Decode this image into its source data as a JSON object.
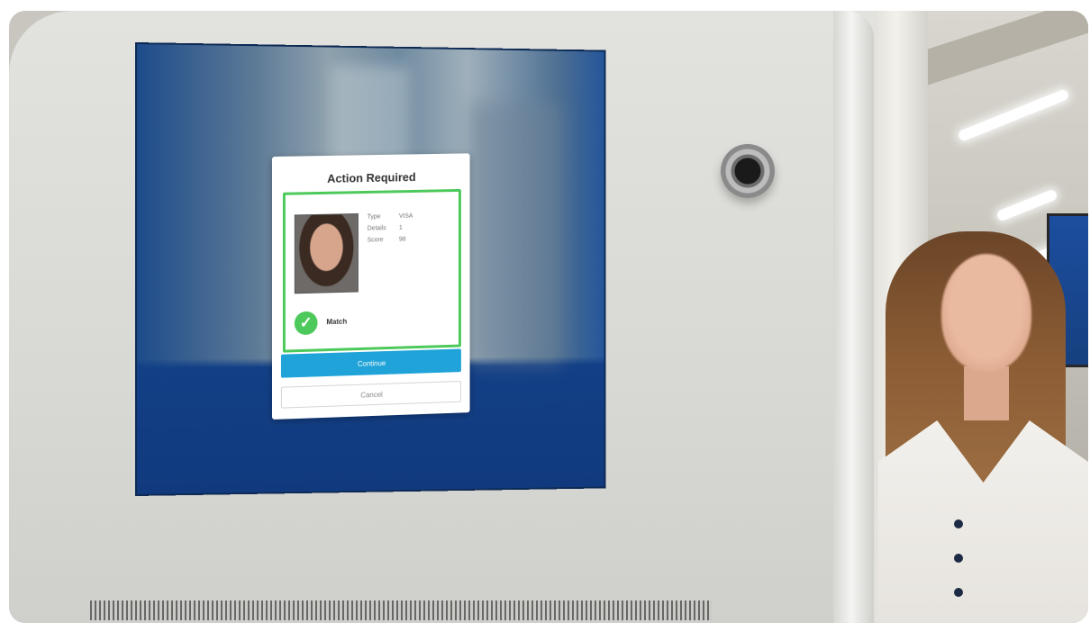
{
  "dialog": {
    "title": "Action Required",
    "fields": [
      {
        "key": "Type",
        "value": "VISA"
      },
      {
        "key": "Details",
        "value": "1"
      },
      {
        "key": "Score",
        "value": "98"
      }
    ],
    "status_label": "Match",
    "status_color": "#4cc95a",
    "primary_button": "Continue",
    "secondary_button": "Cancel"
  },
  "colors": {
    "screen_blue": "#123f86",
    "primary_button": "#1fa3d8",
    "kiosk_body": "#dcdcd8"
  }
}
